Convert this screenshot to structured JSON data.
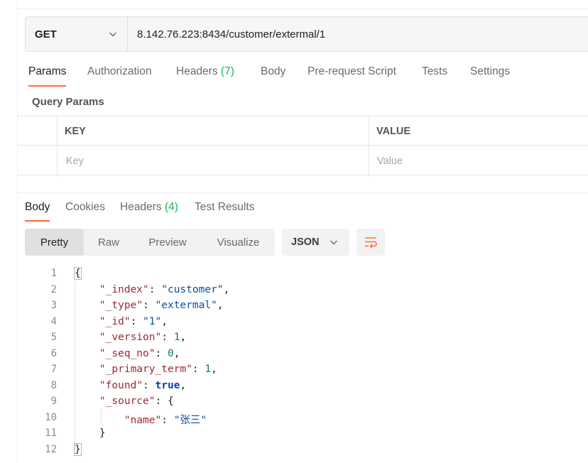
{
  "request": {
    "method": "GET",
    "url": "8.142.76.223:8434/customer/extermal/1"
  },
  "request_tabs": [
    {
      "label": "Params",
      "active": true
    },
    {
      "label": "Authorization"
    },
    {
      "label": "Headers",
      "count": "(7)"
    },
    {
      "label": "Body"
    },
    {
      "label": "Pre-request Script"
    },
    {
      "label": "Tests"
    },
    {
      "label": "Settings"
    }
  ],
  "query_params": {
    "title": "Query Params",
    "columns": [
      "KEY",
      "VALUE"
    ],
    "placeholders": {
      "key": "Key",
      "value": "Value"
    }
  },
  "response_tabs": [
    {
      "label": "Body",
      "active": true
    },
    {
      "label": "Cookies"
    },
    {
      "label": "Headers",
      "count": "(4)"
    },
    {
      "label": "Test Results"
    }
  ],
  "format_buttons": [
    {
      "label": "Pretty",
      "active": true
    },
    {
      "label": "Raw"
    },
    {
      "label": "Preview"
    },
    {
      "label": "Visualize"
    }
  ],
  "language": "JSON",
  "icons": {
    "method_dropdown": "chevron-down-icon",
    "language_dropdown": "chevron-down-icon",
    "wrap": "wrap-lines-icon"
  },
  "colors": {
    "accent": "#ff6c37",
    "count": "#0cbb52",
    "key": "#9c2a35",
    "string": "#0c4fa3",
    "number": "#0e7a6e",
    "boolean": "#0c3fae"
  },
  "code_lines": [
    {
      "n": "1",
      "tokens": [
        {
          "t": "{",
          "c": "q"
        }
      ]
    },
    {
      "n": "2",
      "tokens": [
        {
          "t": "    ",
          "c": "q"
        },
        {
          "t": "\"_index\"",
          "c": "k"
        },
        {
          "t": ": ",
          "c": "q"
        },
        {
          "t": "\"customer\"",
          "c": "s"
        },
        {
          "t": ",",
          "c": "q"
        }
      ]
    },
    {
      "n": "3",
      "tokens": [
        {
          "t": "    ",
          "c": "q"
        },
        {
          "t": "\"_type\"",
          "c": "k"
        },
        {
          "t": ": ",
          "c": "q"
        },
        {
          "t": "\"extermal\"",
          "c": "s"
        },
        {
          "t": ",",
          "c": "q"
        }
      ]
    },
    {
      "n": "4",
      "tokens": [
        {
          "t": "    ",
          "c": "q"
        },
        {
          "t": "\"_id\"",
          "c": "k"
        },
        {
          "t": ": ",
          "c": "q"
        },
        {
          "t": "\"1\"",
          "c": "s"
        },
        {
          "t": ",",
          "c": "q"
        }
      ]
    },
    {
      "n": "5",
      "tokens": [
        {
          "t": "    ",
          "c": "q"
        },
        {
          "t": "\"_version\"",
          "c": "k"
        },
        {
          "t": ": ",
          "c": "q"
        },
        {
          "t": "1",
          "c": "n"
        },
        {
          "t": ",",
          "c": "q"
        }
      ]
    },
    {
      "n": "6",
      "tokens": [
        {
          "t": "    ",
          "c": "q"
        },
        {
          "t": "\"_seq_no\"",
          "c": "k"
        },
        {
          "t": ": ",
          "c": "q"
        },
        {
          "t": "0",
          "c": "n"
        },
        {
          "t": ",",
          "c": "q"
        }
      ]
    },
    {
      "n": "7",
      "tokens": [
        {
          "t": "    ",
          "c": "q"
        },
        {
          "t": "\"_primary_term\"",
          "c": "k"
        },
        {
          "t": ": ",
          "c": "q"
        },
        {
          "t": "1",
          "c": "n"
        },
        {
          "t": ",",
          "c": "q"
        }
      ]
    },
    {
      "n": "8",
      "tokens": [
        {
          "t": "    ",
          "c": "q"
        },
        {
          "t": "\"found\"",
          "c": "k"
        },
        {
          "t": ": ",
          "c": "q"
        },
        {
          "t": "true",
          "c": "b"
        },
        {
          "t": ",",
          "c": "q"
        }
      ]
    },
    {
      "n": "9",
      "tokens": [
        {
          "t": "    ",
          "c": "q"
        },
        {
          "t": "\"_source\"",
          "c": "k"
        },
        {
          "t": ": ",
          "c": "q"
        },
        {
          "t": "{",
          "c": "q"
        }
      ]
    },
    {
      "n": "10",
      "tokens": [
        {
          "t": "        ",
          "c": "q"
        },
        {
          "t": "\"name\"",
          "c": "k"
        },
        {
          "t": ": ",
          "c": "q"
        },
        {
          "t": "\"张三\"",
          "c": "s"
        }
      ]
    },
    {
      "n": "11",
      "tokens": [
        {
          "t": "    ",
          "c": "q"
        },
        {
          "t": "}",
          "c": "q"
        }
      ]
    },
    {
      "n": "12",
      "tokens": [
        {
          "t": "}",
          "c": "q"
        }
      ]
    }
  ]
}
